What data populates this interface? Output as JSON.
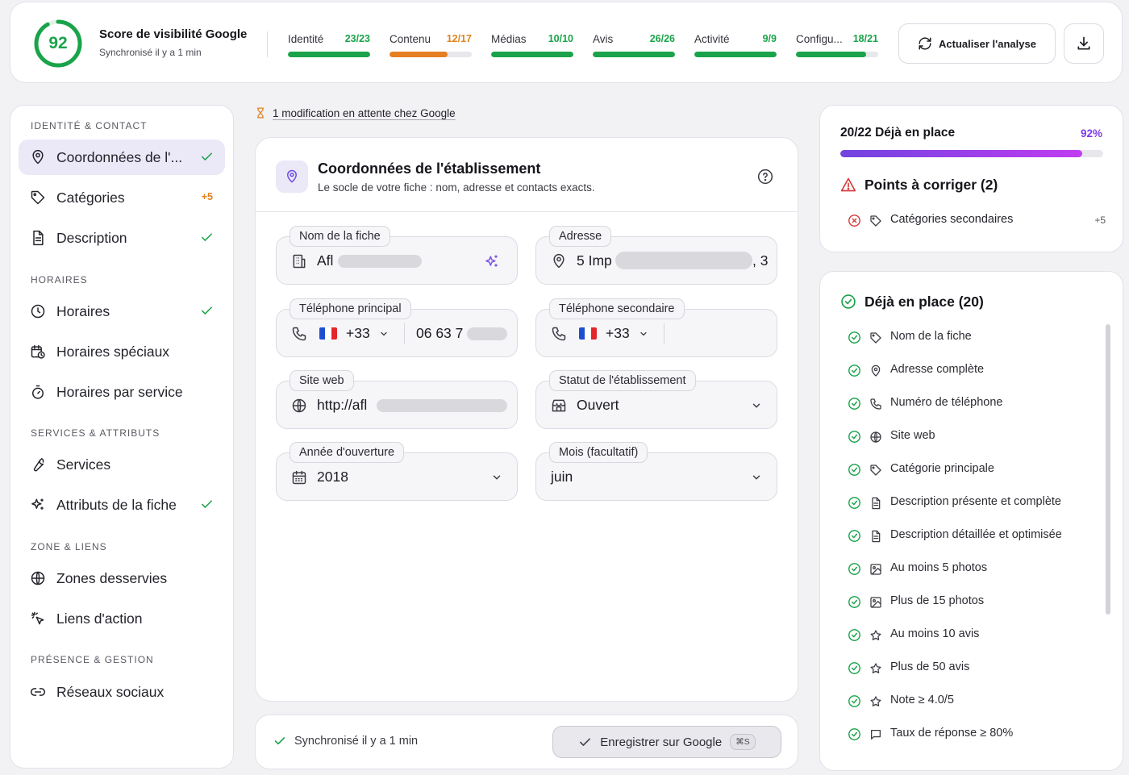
{
  "header": {
    "score": "92",
    "score_fraction": 0.92,
    "title": "Score de visibilité Google",
    "subtitle": "Synchronisé il y a 1 min",
    "metrics": [
      {
        "label": "Identité",
        "value": "23/23",
        "ratio": 1.0,
        "color": "green"
      },
      {
        "label": "Contenu",
        "value": "12/17",
        "ratio": 0.706,
        "color": "orange"
      },
      {
        "label": "Médias",
        "value": "10/10",
        "ratio": 1.0,
        "color": "green"
      },
      {
        "label": "Avis",
        "value": "26/26",
        "ratio": 1.0,
        "color": "green"
      },
      {
        "label": "Activité",
        "value": "9/9",
        "ratio": 1.0,
        "color": "green"
      },
      {
        "label": "Configu...",
        "value": "18/21",
        "ratio": 0.857,
        "color": "green"
      }
    ],
    "refresh_label": "Actualiser l'analyse",
    "download_icon": "download-icon"
  },
  "sidebar": {
    "sections": [
      {
        "title": "IDENTITÉ & CONTACT",
        "items": [
          {
            "label": "Coordonnées de l'...",
            "icon": "map-pin-icon",
            "status": "check",
            "active": true
          },
          {
            "label": "Catégories",
            "icon": "tag-icon",
            "status": "badge",
            "badge": "+5"
          },
          {
            "label": "Description",
            "icon": "document-icon",
            "status": "check"
          }
        ]
      },
      {
        "title": "HORAIRES",
        "items": [
          {
            "label": "Horaires",
            "icon": "clock-icon",
            "status": "check"
          },
          {
            "label": "Horaires spéciaux",
            "icon": "calendar-clock-icon",
            "status": ""
          },
          {
            "label": "Horaires par service",
            "icon": "timer-icon",
            "status": ""
          }
        ]
      },
      {
        "title": "SERVICES & ATTRIBUTS",
        "items": [
          {
            "label": "Services",
            "icon": "wrench-icon",
            "status": ""
          },
          {
            "label": "Attributs de la fiche",
            "icon": "sparkles-icon",
            "status": "check"
          }
        ]
      },
      {
        "title": "ZONE & LIENS",
        "items": [
          {
            "label": "Zones desservies",
            "icon": "globe-icon",
            "status": ""
          },
          {
            "label": "Liens d'action",
            "icon": "click-icon",
            "status": ""
          }
        ]
      },
      {
        "title": "PRÉSENCE & GESTION",
        "items": [
          {
            "label": "Réseaux sociaux",
            "icon": "link-icon",
            "status": ""
          }
        ]
      }
    ]
  },
  "pending": "1 modification en attente chez Google",
  "form": {
    "title": "Coordonnées de l'établissement",
    "subtitle": "Le socle de votre fiche : nom, adresse et contacts exacts.",
    "fields": {
      "name": {
        "label": "Nom de la fiche",
        "value": "Afl"
      },
      "address": {
        "label": "Adresse",
        "value": "5 Imp",
        "suffix": ", 3"
      },
      "phone_main": {
        "label": "Téléphone principal",
        "code": "+33",
        "value": "06 63 7"
      },
      "phone_sec": {
        "label": "Téléphone secondaire",
        "code": "+33",
        "value": ""
      },
      "website": {
        "label": "Site web",
        "value": "http://afl"
      },
      "status": {
        "label": "Statut de l'établissement",
        "value": "Ouvert"
      },
      "year": {
        "label": "Année d'ouverture",
        "value": "2018"
      },
      "month": {
        "label": "Mois (facultatif)",
        "value": "juin"
      }
    }
  },
  "save_bar": {
    "sync": "Synchronisé il y a 1 min",
    "save_label": "Enregistrer sur Google",
    "shortcut": "⌘S"
  },
  "progress": {
    "title": "20/22 Déjà en place",
    "percent": "92%",
    "ratio": 0.92,
    "fix_title": "Points à corriger (2)",
    "fix_items": [
      {
        "label": "Catégories secondaires",
        "badge": "+5",
        "icon": "tag-icon"
      }
    ]
  },
  "done": {
    "title": "Déjà en place (20)",
    "items": [
      {
        "label": "Nom de la fiche",
        "icon": "tag-icon"
      },
      {
        "label": "Adresse complète",
        "icon": "map-pin-icon"
      },
      {
        "label": "Numéro de téléphone",
        "icon": "phone-icon"
      },
      {
        "label": "Site web",
        "icon": "globe-icon"
      },
      {
        "label": "Catégorie principale",
        "icon": "tag-icon"
      },
      {
        "label": "Description présente et complète",
        "icon": "document-icon"
      },
      {
        "label": "Description détaillée et optimisée",
        "icon": "document-icon"
      },
      {
        "label": "Au moins 5 photos",
        "icon": "image-icon"
      },
      {
        "label": "Plus de 15 photos",
        "icon": "image-icon"
      },
      {
        "label": "Au moins 10 avis",
        "icon": "star-icon"
      },
      {
        "label": "Plus de 50 avis",
        "icon": "star-icon"
      },
      {
        "label": "Note ≥ 4.0/5",
        "icon": "star-icon"
      },
      {
        "label": "Taux de réponse ≥ 80%",
        "icon": "message-icon"
      }
    ]
  },
  "colors": {
    "green": "#1aa34a",
    "orange": "#e67e22",
    "purple": "#7c3aed",
    "red": "#d63b3b"
  }
}
